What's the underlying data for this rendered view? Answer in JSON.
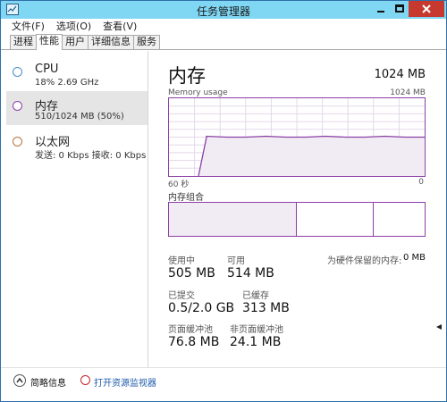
{
  "window": {
    "title": "任务管理器"
  },
  "menu": [
    "文件(F)",
    "选项(O)",
    "查看(V)"
  ],
  "tabs": [
    {
      "label": "进程",
      "active": false
    },
    {
      "label": "性能",
      "active": true
    },
    {
      "label": "用户",
      "active": false
    },
    {
      "label": "详细信息",
      "active": false
    },
    {
      "label": "服务",
      "active": false
    }
  ],
  "sidebar": [
    {
      "title": "CPU",
      "sub": "18% 2.69 GHz",
      "color": "#4a90c8",
      "selected": false
    },
    {
      "title": "内存",
      "sub": "510/1024 MB (50%)",
      "color": "#8b3fa6",
      "selected": true
    },
    {
      "title": "以太网",
      "sub": "发送: 0 Kbps 接收: 0 Kbps",
      "color": "#b8733a",
      "selected": false
    }
  ],
  "main": {
    "title": "内存",
    "total": "1024 MB",
    "graph_label": "Memory usage",
    "graph_max": "1024 MB",
    "axis_left": "60 秒",
    "axis_right": "0",
    "composition_label": "内存组合",
    "composition": {
      "in_use_fraction": 0.5,
      "modified_fraction": 0.0,
      "standby_fraction": 0.3
    },
    "usage_history_fraction": [
      0,
      0,
      0,
      0,
      0.5,
      0.5,
      0.5,
      0.5,
      0.5,
      0.5,
      0.5,
      0.5
    ],
    "stats": {
      "in_use_label": "使用中",
      "in_use_value": "505 MB",
      "available_label": "可用",
      "available_value": "514 MB",
      "reserved_label": "为硬件保留的内存:",
      "reserved_value": "0 MB",
      "committed_label": "已提交",
      "committed_value": "0.5/2.0 GB",
      "cached_label": "已缓存",
      "cached_value": "313 MB",
      "paged_label": "页面缓冲池",
      "paged_value": "76.8 MB",
      "nonpaged_label": "非页面缓冲池",
      "nonpaged_value": "24.1 MB"
    }
  },
  "footer": {
    "summary": "简略信息",
    "resource_monitor": "打开资源监视器"
  },
  "colors": {
    "memory": "#8b3fa6",
    "titlebar": "#7fd7f4",
    "close": "#c7392f",
    "link": "#1e5aa8"
  }
}
